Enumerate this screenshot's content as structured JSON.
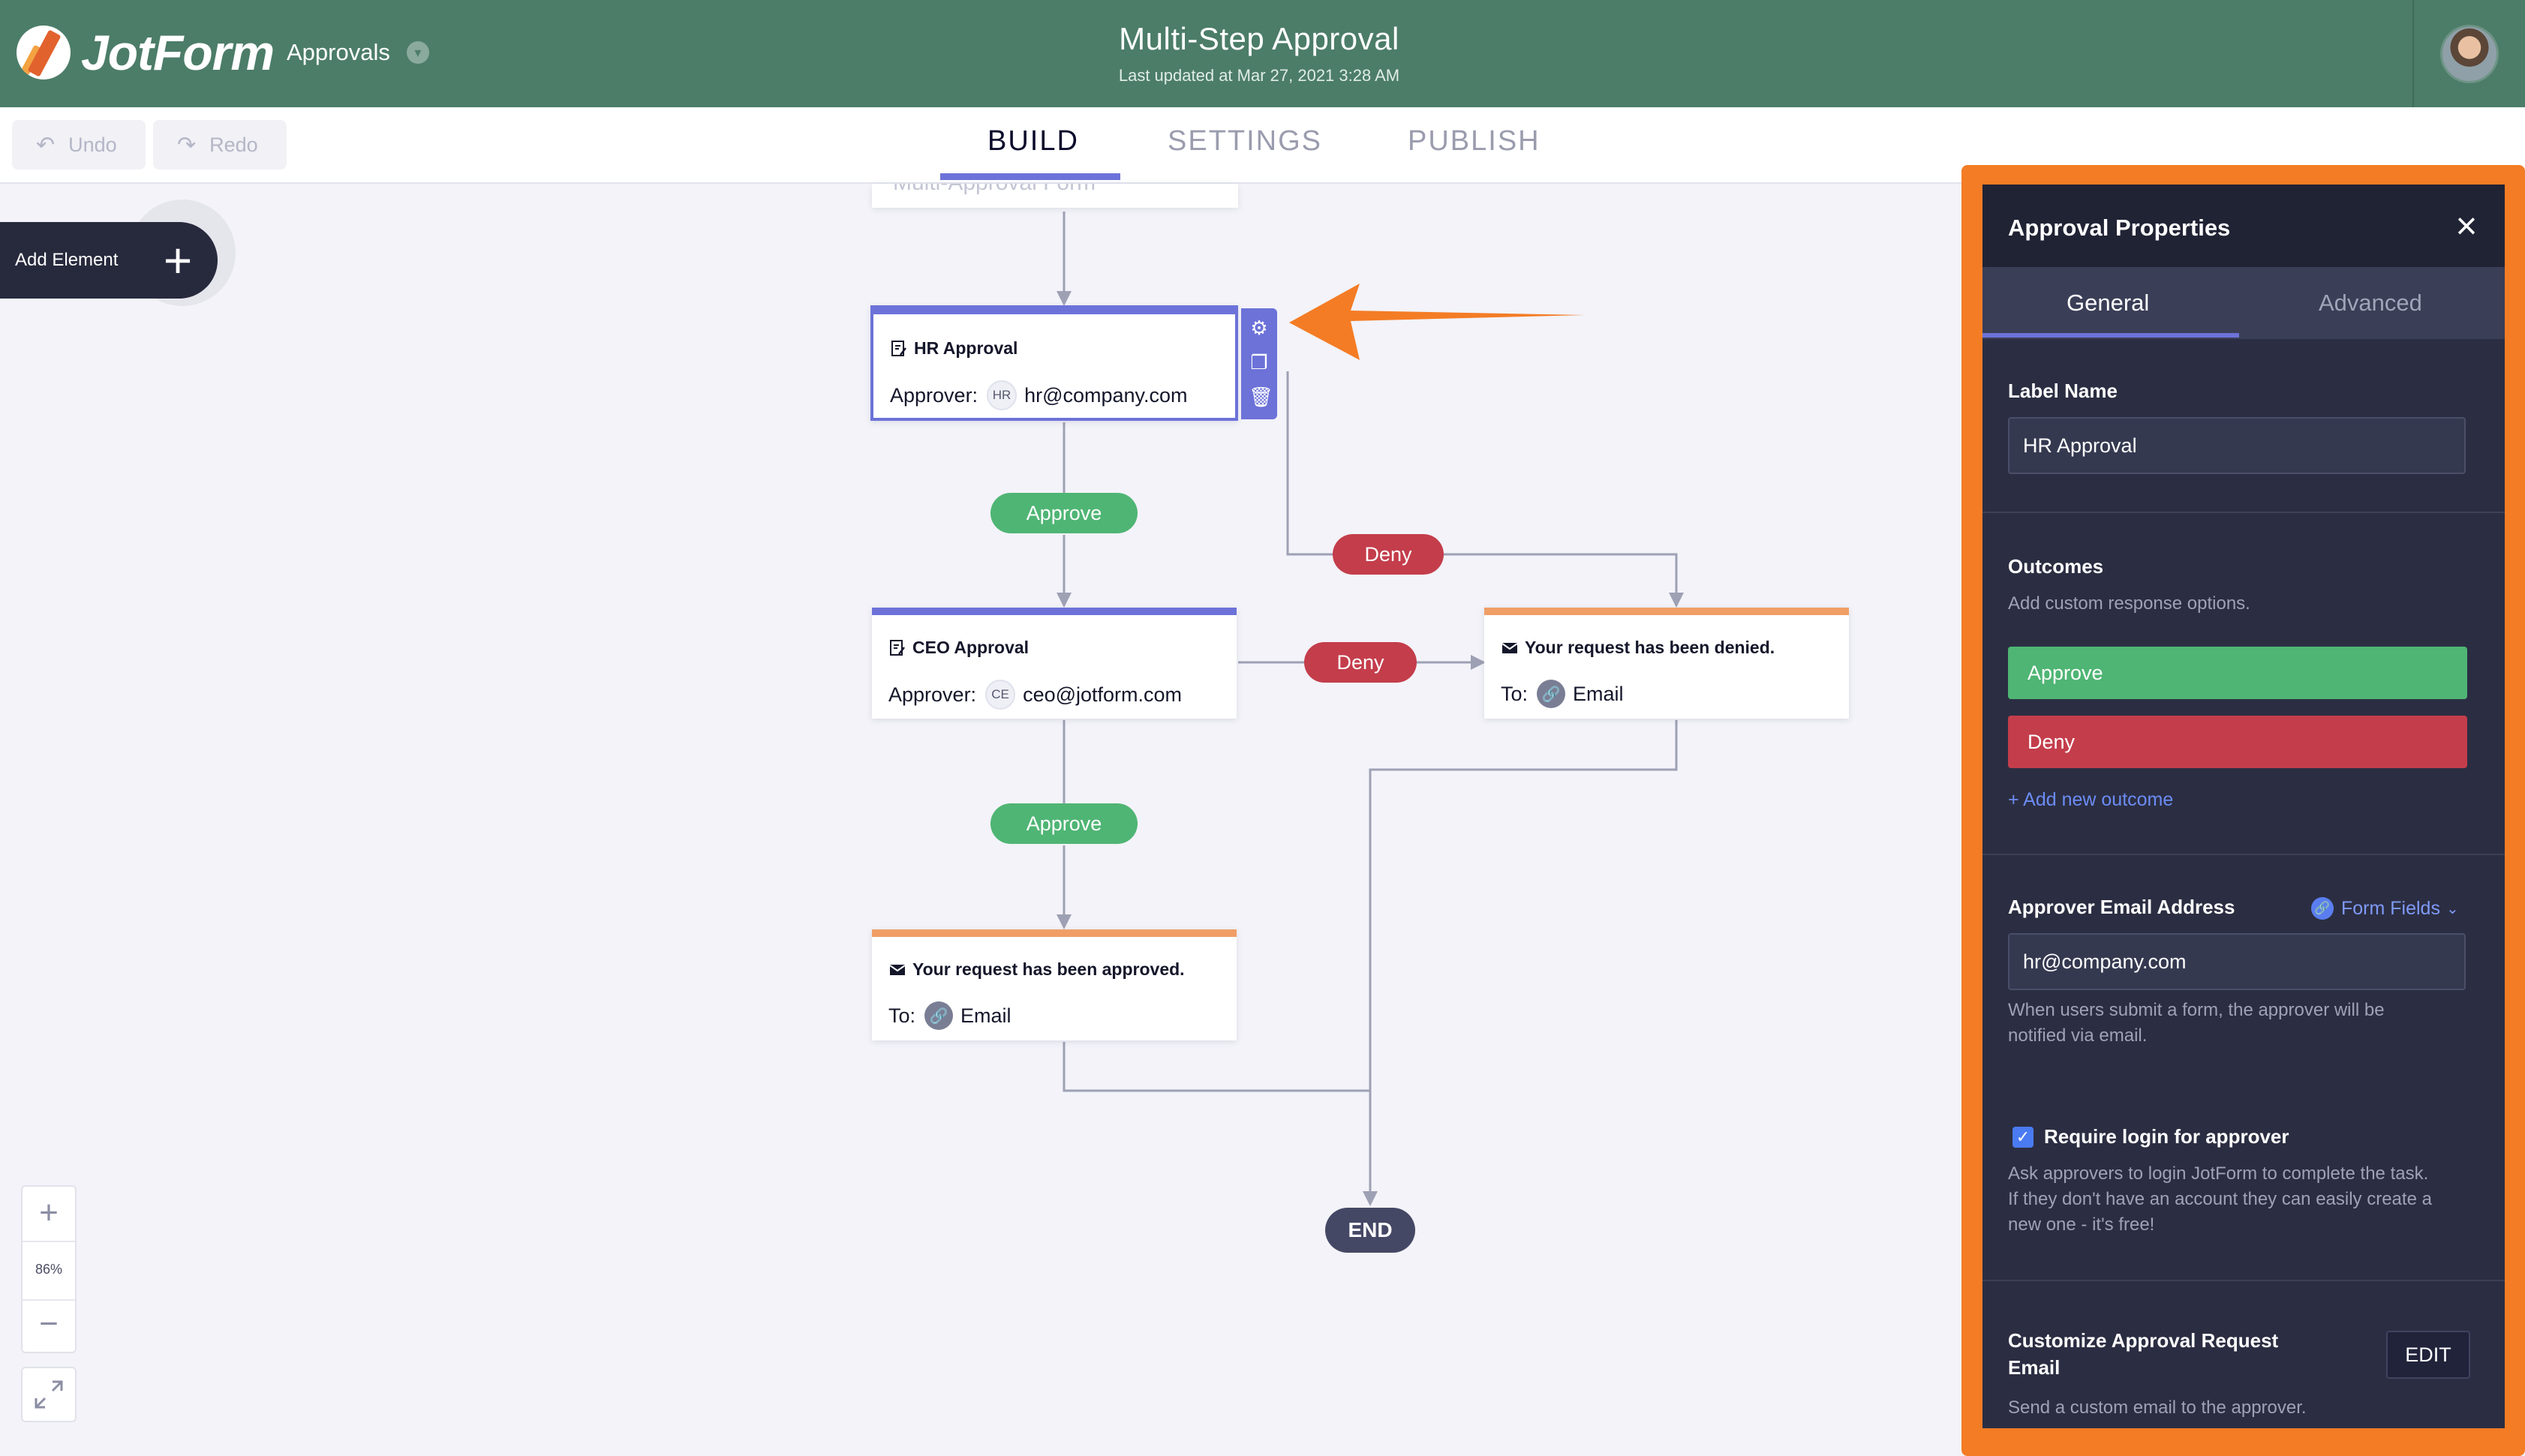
{
  "header": {
    "brand": "JotForm",
    "section_dropdown": "Approvals",
    "title": "Multi-Step Approval",
    "last_updated": "Last updated at Mar 27, 2021 3:28 AM"
  },
  "toolbar": {
    "undo_label": "Undo",
    "redo_label": "Redo",
    "tabs": [
      {
        "label": "BUILD",
        "active": true
      },
      {
        "label": "SETTINGS",
        "active": false
      },
      {
        "label": "PUBLISH",
        "active": false
      }
    ]
  },
  "canvas": {
    "add_element_label": "Add Element",
    "ghost_node_text": "Multi-Approval Form",
    "nodes": {
      "hr": {
        "title": "HR Approval",
        "approver_label": "Approver:",
        "initials": "HR",
        "email": "hr@company.com"
      },
      "ceo": {
        "title": "CEO Approval",
        "approver_label": "Approver:",
        "initials": "CE",
        "email": "ceo@jotform.com"
      },
      "denied": {
        "title": "Your request has been denied.",
        "to_label": "To:",
        "recipient": "Email"
      },
      "approved": {
        "title": "Your request has been approved.",
        "to_label": "To:",
        "recipient": "Email"
      }
    },
    "edges": {
      "approve_1": "Approve",
      "approve_2": "Approve",
      "deny_1": "Deny",
      "deny_2": "Deny"
    },
    "end_label": "END",
    "zoom": {
      "level": "86%"
    }
  },
  "panel": {
    "title": "Approval Properties",
    "tabs": [
      {
        "label": "General",
        "active": true
      },
      {
        "label": "Advanced",
        "active": false
      }
    ],
    "label_name": {
      "label": "Label Name",
      "value": "HR Approval"
    },
    "outcomes": {
      "label": "Outcomes",
      "description": "Add custom response options.",
      "items": [
        {
          "label": "Approve"
        },
        {
          "label": "Deny"
        }
      ],
      "add_link": "+ Add new outcome"
    },
    "approver_email": {
      "label": "Approver Email Address",
      "form_fields_label": "Form Fields",
      "value": "hr@company.com",
      "help_line1": "When users submit a form, the approver will be",
      "help_line2": "notified via email."
    },
    "require_login": {
      "label": "Require login for approver",
      "checked": true,
      "help_line1": "Ask approvers to login JotForm to complete the task.",
      "help_line2": "If they don't have an account they can easily create a",
      "help_line3": "new one - it's free!"
    },
    "customize_email": {
      "label_line1": "Customize Approval Request",
      "label_line2": "Email",
      "description": "Send a custom email to the approver.",
      "edit_label": "EDIT"
    }
  },
  "colors": {
    "header": "#4c7d69",
    "accent": "#6c72d8",
    "approve": "#4fb574",
    "deny": "#c43d4b",
    "highlight": "#f47c25",
    "panel_bg": "#2b2e42"
  }
}
